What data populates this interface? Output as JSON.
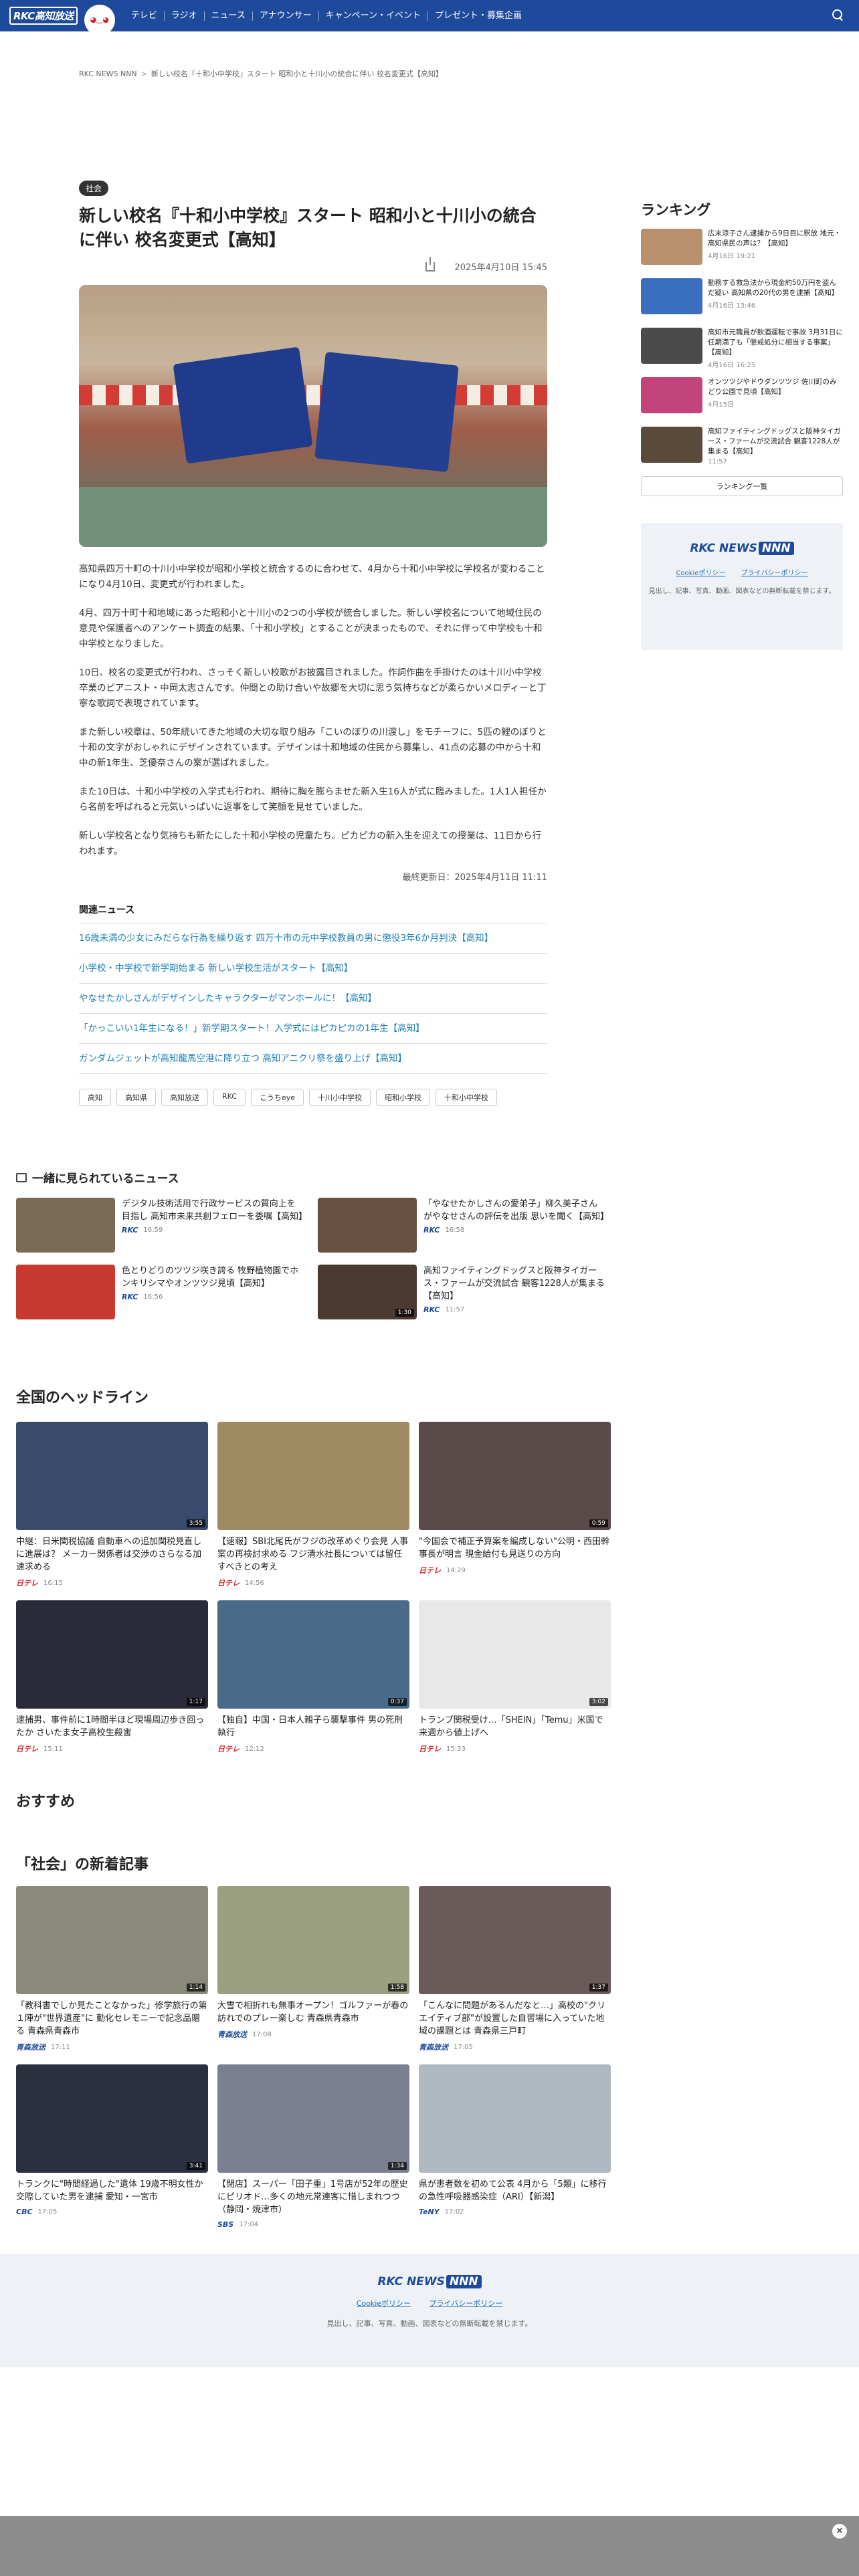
{
  "header": {
    "logo": "RKC高知放送",
    "nav": [
      "テレビ",
      "ラジオ",
      "ニュース",
      "アナウンサー",
      "キャンペーン・イベント",
      "プレゼント・募集企画"
    ]
  },
  "breadcrumb": [
    "RKC NEWS NNN",
    "新しい校名『十和小中学校』スタート 昭和小と十川小の統合に伴い 校名変更式【高知】"
  ],
  "article": {
    "category": "社会",
    "title": "新しい校名『十和小中学校』スタート 昭和小と十川小の統合に伴い 校名変更式【高知】",
    "date": "2025年4月10日 15:45",
    "paragraphs": [
      "高知県四万十町の十川小中学校が昭和小学校と統合するのに合わせて、4月から十和小中学校に学校名が変わることになり4月10日、変更式が行われました。",
      "4月、四万十町十和地域にあった昭和小と十川小の2つの小学校が統合しました。新しい学校名について地域住民の意見や保護者へのアンケート調査の結果、「十和小学校」とすることが決まったもので、それに伴って中学校も十和中学校となりました。",
      "10日、校名の変更式が行われ、さっそく新しい校歌がお披露目されました。作詞作曲を手掛けたのは十川小中学校卒業のピアニスト・中岡太志さんです。仲間との助け合いや故郷を大切に思う気持ちなどが柔らかいメロディーと丁寧な歌詞で表現されています。",
      "また新しい校章は、50年続いてきた地域の大切な取り組み「こいのぼりの川渡し」をモチーフに、5匹の鯉のぼりと十和の文字がおしゃれにデザインされています。デザインは十和地域の住民から募集し、41点の応募の中から十和中の新1年生、芝優奈さんの案が選ばれました。",
      "また10日は、十和小中学校の入学式も行われ、期待に胸を膨らませた新入生16人が式に臨みました。1人1人担任から名前を呼ばれると元気いっぱいに返事をして笑顔を見せていました。",
      "新しい学校名となり気持ちも新たにした十和小学校の児童たち。ピカピカの新入生を迎えての授業は、11日から行われます。"
    ],
    "updated": "最終更新日：2025年4月11日 11:11",
    "related_heading": "関連ニュース",
    "related": [
      "16歳未満の少女にみだらな行為を繰り返す 四万十市の元中学校教員の男に懲役3年6か月判決【高知】",
      "小学校・中学校で新学期始まる 新しい学校生活がスタート【高知】",
      "やなせたかしさんがデザインしたキャラクターがマンホールに！【高知】",
      "「かっこいい1年生になる！」新学期スタート！入学式にはピカピカの1年生【高知】",
      "ガンダムジェットが高知龍馬空港に降り立つ 高知アニクリ祭を盛り上げ【高知】"
    ],
    "tags": [
      "高知",
      "高知県",
      "高知放送",
      "RKC",
      "こうちeye",
      "十川小中学校",
      "昭和小学校",
      "十和小中学校"
    ]
  },
  "ranking": {
    "heading": "ランキング",
    "items": [
      {
        "title": "広末涼子さん逮捕から9日目に釈放 地元・高知県民の声は？【高知】",
        "time": "4月16日 19:21",
        "color": "#b8906c"
      },
      {
        "title": "勤務する救急法から現金約50万円を盗んだ疑い 高知県の20代の男を逮捕【高知】",
        "time": "4月16日 13:46",
        "color": "#3a6fc0"
      },
      {
        "title": "高知市元職員が飲酒運転で事故 3月31日に任期満了も「懲戒処分に相当する事案」【高知】",
        "time": "4月16日 16:25",
        "color": "#4a4a4a"
      },
      {
        "title": "オンツツジやドウダンツツジ 佐川町のみどり公園で見頃【高知】",
        "time": "4月15日",
        "color": "#c2447a"
      },
      {
        "title": "高知ファイティングドッグスと阪神タイガース・ファームが交流試合 観客1228人が集まる【高知】",
        "time": "11:57",
        "color": "#5a4a3a"
      }
    ],
    "button": "ランキング一覧"
  },
  "side_box": {
    "logo": "RKC NEWS",
    "logo_tag": "NNN",
    "links": [
      "Cookieポリシー",
      "プライバシーポリシー"
    ],
    "note": "見出し、記事、写真、動画、図表などの無断転載を禁じます。"
  },
  "together": {
    "heading": "一緒に見られているニュース",
    "items": [
      {
        "title": "デジタル技術活用で行政サービスの質向上を目指し 高知市未来共創フェローを委嘱【高知】",
        "source": "RKC",
        "time": "16:59",
        "color": "#7a6a55",
        "duration": ""
      },
      {
        "title": "「やなせたかしさんの愛弟子」柳久美子さんがやなせさんの評伝を出版 思いを聞く【高知】",
        "source": "RKC",
        "time": "16:58",
        "color": "#6a5040",
        "duration": ""
      },
      {
        "title": "色とりどりのツツジ咲き誇る 牧野植物園でホンキリシマやオンツツジ見頃【高知】",
        "source": "RKC",
        "time": "16:56",
        "color": "#c83a30",
        "duration": ""
      },
      {
        "title": "高知ファイティングドッグスと阪神タイガース・ファームが交流試合 観客1228人が集まる【高知】",
        "source": "RKC",
        "time": "11:57",
        "color": "#4a3a30",
        "duration": "1:30"
      }
    ]
  },
  "headlines": {
    "heading": "全国のヘッドライン",
    "items": [
      {
        "title": "中継：日米関税協議 自動車への追加関税見直しに進展は？ メーカー関係者は交渉のさらなる加速求める",
        "source": "日テレ",
        "time": "16:15",
        "color": "#3a4a6a",
        "duration": "3:55"
      },
      {
        "title": "【速報】SBI北尾氏がフジの改革めぐり会見 人事案の再検討求める フジ清水社長については留任すべきとの考え",
        "source": "日テレ",
        "time": "14:56",
        "color": "#a08a60",
        "duration": ""
      },
      {
        "title": "\"今国会で補正予算案を編成しない\"公明・西田幹事長が明言 現金給付も見送りの方向",
        "source": "日テレ",
        "time": "14:29",
        "color": "#5a4a4a",
        "duration": "0:59"
      },
      {
        "title": "逮捕男、事件前に1時間半ほど現場周辺歩き回ったか さいたま女子高校生殺害",
        "source": "日テレ",
        "time": "15:11",
        "color": "#2a2a3a",
        "duration": "1:17"
      },
      {
        "title": "【独自】中国・日本人親子ら襲撃事件 男の死刑執行",
        "source": "日テレ",
        "time": "12:12",
        "color": "#4a6a8a",
        "duration": "0:37"
      },
      {
        "title": "トランプ関税受け…「SHEIN」「Temu」米国で来週から値上げへ",
        "source": "日テレ",
        "time": "15:33",
        "color": "#e8e8e8",
        "duration": "3:02"
      }
    ]
  },
  "recommend": {
    "heading": "おすすめ"
  },
  "social": {
    "heading": "「社会」の新着記事",
    "items": [
      {
        "title": "「教科書でしか見たことなかった」修学旅行の第１陣が\"世界遺産\"に 勤化セレモニーで記念品贈る 青森県青森市",
        "source": "青森放送",
        "time": "17:11",
        "color": "#8a8a7a",
        "duration": "1:14"
      },
      {
        "title": "大雪で相折れも無事オープン！ゴルファーが春の訪れでのプレー楽しむ 青森県青森市",
        "source": "青森放送",
        "time": "17:08",
        "color": "#9aa080",
        "duration": "1:58"
      },
      {
        "title": "「こんなに問題があるんだなと…」高校の\"クリエイティブ部\"が設置した自習場に入っていた地域の課題とは 青森県三戸町",
        "source": "青森放送",
        "time": "17:05",
        "color": "#6a5a5a",
        "duration": "1:37"
      },
      {
        "title": "トランクに\"時間経過した\"遺体 19歳不明女性か 交際していた男を逮捕 愛知・一宮市",
        "source": "CBC",
        "time": "17:05",
        "color": "#2a3040",
        "duration": "3:41"
      },
      {
        "title": "【閉店】スーパー「田子重」1号店が52年の歴史にピリオド…多くの地元常連客に惜しまれつつ（静岡・焼津市）",
        "source": "SBS",
        "time": "17:04",
        "color": "#7a8090",
        "duration": "1:34"
      },
      {
        "title": "県が患者数を初めて公表 4月から「5類」に移行の急性呼吸器感染症（ARI）【新潟】",
        "source": "TeNY",
        "time": "17:02",
        "color": "#b0b8c0",
        "duration": ""
      }
    ]
  },
  "footer": {
    "logo": "RKC NEWS",
    "logo_tag": "NNN",
    "links": [
      "Cookieポリシー",
      "プライバシーポリシー"
    ],
    "note": "見出し、記事、写真、動画、図表などの無断転載を禁じます。"
  },
  "ad": {
    "close": "✕"
  }
}
